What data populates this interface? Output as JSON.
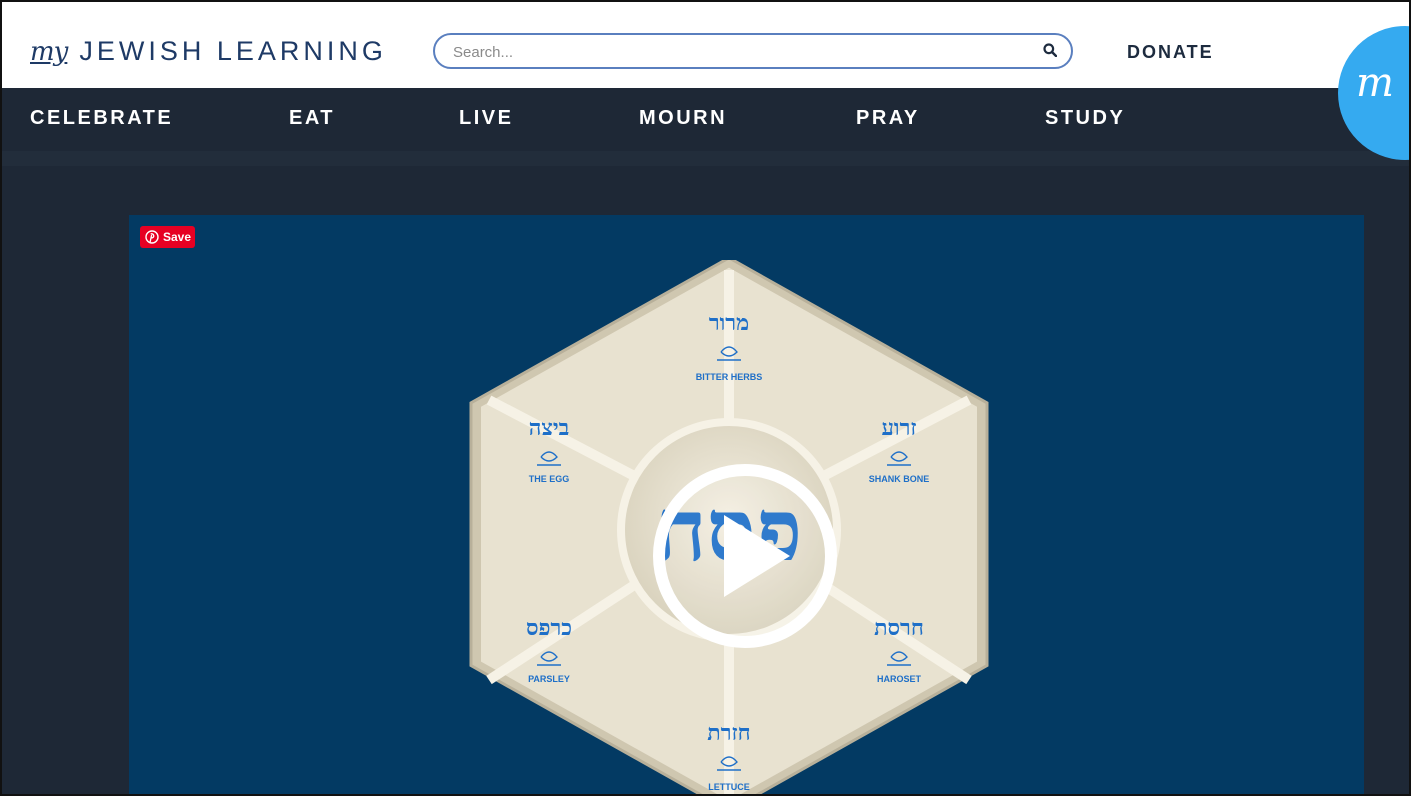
{
  "header": {
    "logo_my": "my",
    "logo_name": "JEWISH LEARNING",
    "search_placeholder": "Search...",
    "donate_label": "DONATE",
    "badge_text": "m"
  },
  "nav": {
    "items": [
      "CELEBRATE",
      "EAT",
      "LIVE",
      "MOURN",
      "PRAY",
      "STUDY"
    ]
  },
  "video": {
    "save_label": "Save",
    "plate": {
      "center_hebrew": "פסח",
      "sections": [
        {
          "hebrew": "מרור",
          "english": "BITTER HERBS"
        },
        {
          "hebrew": "זרוע",
          "english": "SHANK BONE"
        },
        {
          "hebrew": "חרסת",
          "english": "HAROSET"
        },
        {
          "hebrew": "חזרת",
          "english": "LETTUCE"
        },
        {
          "hebrew": "כרפס",
          "english": "PARSLEY"
        },
        {
          "hebrew": "ביצה",
          "english": "THE EGG"
        }
      ]
    }
  },
  "colors": {
    "nav_bg": "#1e2836",
    "video_bg": "#033a63",
    "plate": "#e8e2d0",
    "accent_blue": "#1e6fc8",
    "badge": "#35aaf0",
    "pinterest": "#e60023"
  }
}
